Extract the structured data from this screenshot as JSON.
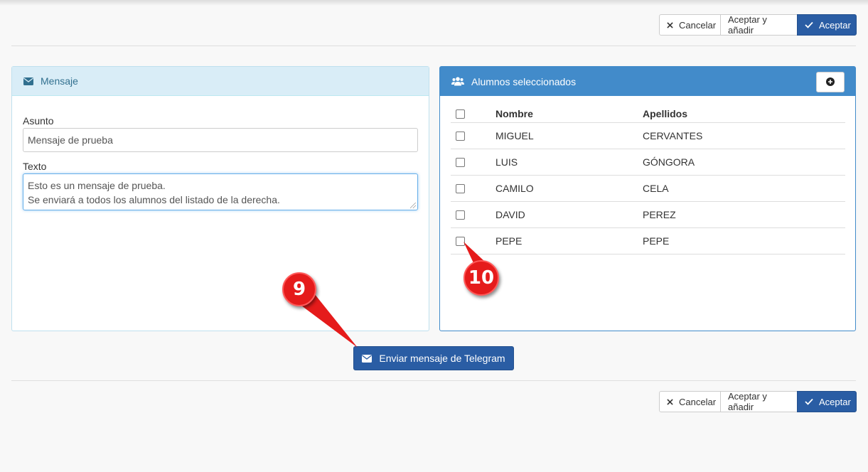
{
  "toolbar": {
    "cancel_label": "Cancelar",
    "accept_add_label": "Aceptar y añadir",
    "accept_label": "Aceptar"
  },
  "message_panel": {
    "title": "Mensaje",
    "subject_label": "Asunto",
    "subject_value": "Mensaje de prueba",
    "text_label": "Texto",
    "text_lines": [
      "Esto es un mensaje de prueba.",
      "Se enviará a todos los alumnos del listado de la derecha."
    ]
  },
  "students_panel": {
    "title": "Alumnos seleccionados",
    "columns": [
      "Nombre",
      "Apellidos"
    ],
    "rows": [
      {
        "nombre": "MIGUEL",
        "apellidos": "CERVANTES",
        "checked": false
      },
      {
        "nombre": "LUIS",
        "apellidos": "GÓNGORA",
        "checked": false
      },
      {
        "nombre": "CAMILO",
        "apellidos": "CELA",
        "checked": false
      },
      {
        "nombre": "DAVID",
        "apellidos": "PEREZ",
        "checked": false
      },
      {
        "nombre": "PEPE",
        "apellidos": "PEPE",
        "checked": false
      }
    ]
  },
  "send_button_label": "Enviar mensaje de Telegram",
  "callouts": [
    "9",
    "10"
  ],
  "colors": {
    "primary": "#2a5da4",
    "info_panel_bg": "#d9edf7",
    "students_header": "#428bca",
    "callout": "#e51b1b"
  }
}
